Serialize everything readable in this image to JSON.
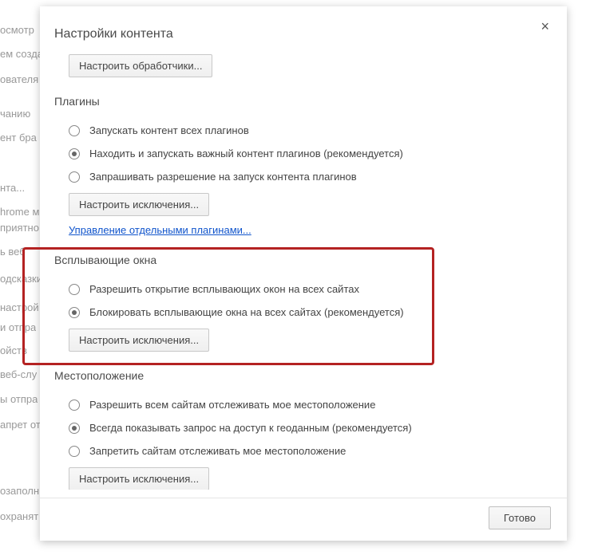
{
  "modal": {
    "title": "Настройки контента",
    "close_symbol": "×",
    "done_button": "Готово"
  },
  "content_settings": {
    "configure_handlers_btn": "Настроить обработчики..."
  },
  "plugins": {
    "title": "Плагины",
    "options": [
      {
        "label": "Запускать контент всех плагинов",
        "checked": false
      },
      {
        "label": "Находить и запускать важный контент плагинов (рекомендуется)",
        "checked": true
      },
      {
        "label": "Запрашивать разрешение на запуск контента плагинов",
        "checked": false
      }
    ],
    "exceptions_btn": "Настроить исключения...",
    "manage_plugins_link": "Управление отдельными плагинами..."
  },
  "popups": {
    "title": "Всплывающие окна",
    "options": [
      {
        "label": "Разрешить открытие всплывающих окон на всех сайтах",
        "checked": false
      },
      {
        "label": "Блокировать всплывающие окна на всех сайтах (рекомендуется)",
        "checked": true
      }
    ],
    "exceptions_btn": "Настроить исключения..."
  },
  "location": {
    "title": "Местоположение",
    "options": [
      {
        "label": "Разрешить всем сайтам отслеживать мое местоположение",
        "checked": false
      },
      {
        "label": "Всегда показывать запрос на доступ к геоданным (рекомендуется)",
        "checked": true
      },
      {
        "label": "Запретить сайтам отслеживать мое местоположение",
        "checked": false
      }
    ],
    "exceptions_btn": "Настроить исключения..."
  },
  "background_text": {
    "l1": "осмотр",
    "l2": "ем созда",
    "l3": "ователя",
    "l4": "чанию",
    "l5": "ент бра",
    "l6": "нта...",
    "l7": "hrome м",
    "l8": "приятно",
    "l9": "ь веб",
    "l10": "одсказки",
    "l11": "настрой",
    "l12": "и отпра",
    "l13": "ойств",
    "l14": "веб-слу",
    "l15": "ы отпра",
    "l16": "апрет от",
    "l17": "озаполн",
    "l18": "охранят"
  }
}
